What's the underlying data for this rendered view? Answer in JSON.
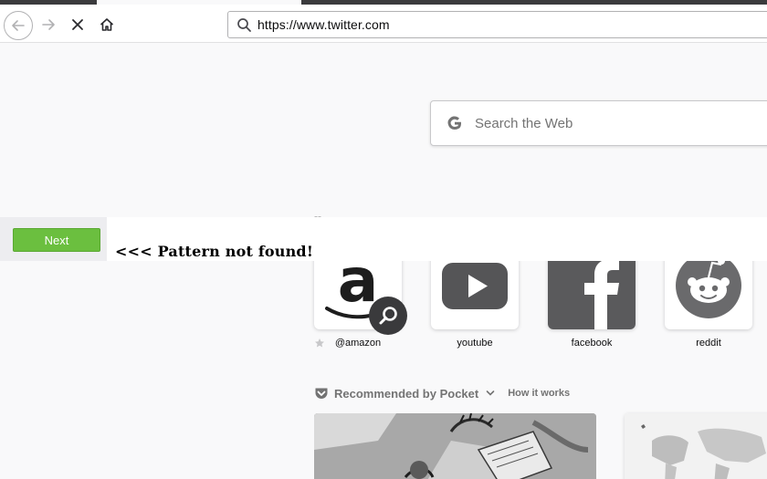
{
  "browser": {
    "url": "https://www.twitter.com"
  },
  "search": {
    "placeholder": "Search the Web"
  },
  "findbar": {
    "next_label": "Next",
    "message": "<<< Pattern not found!"
  },
  "collapsed_section_marker": "--",
  "top_sites": [
    {
      "label": "@amazon",
      "icon": "amazon-icon"
    },
    {
      "label": "youtube",
      "icon": "youtube-icon"
    },
    {
      "label": "facebook",
      "icon": "facebook-icon"
    },
    {
      "label": "reddit",
      "icon": "reddit-icon"
    }
  ],
  "pocket": {
    "title": "Recommended by Pocket",
    "how_it_works": "How it works"
  },
  "colors": {
    "next_button": "#6bbf3f",
    "chrome_dark": "#3b3b3d",
    "page_background": "#f9f9fa"
  }
}
